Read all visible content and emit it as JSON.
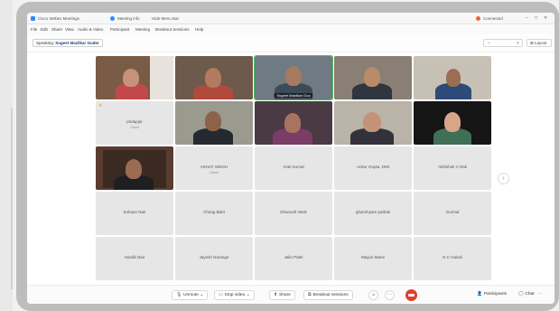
{
  "titlebar": {
    "app_title": "Cisco Webex Meetings",
    "meeting_info": "Meeting info",
    "hide_menu": "Hide Menu Bar",
    "connected": "Connected",
    "win_controls": [
      "–",
      "□",
      "✕"
    ]
  },
  "menubar": {
    "items": [
      "File",
      "Edit",
      "Share",
      "View",
      "Audio & Video",
      "Participant",
      "Meeting",
      "Breakout Sessions",
      "Help"
    ]
  },
  "speaking": {
    "prefix": "Speaking:",
    "name": "Sugeet Mazilkar Guder"
  },
  "view": {
    "zoom_minus": "−",
    "zoom_plus": "+",
    "gallery_label": "Layout"
  },
  "tiles": [
    {
      "name": "",
      "kind": "video"
    },
    {
      "name": "",
      "kind": "video"
    },
    {
      "name": "Sugeet Mazilkar Guo",
      "kind": "video",
      "active": true
    },
    {
      "name": "",
      "kind": "video"
    },
    {
      "name": "",
      "kind": "video"
    },
    {
      "name": "pridupjar",
      "kind": "name",
      "sub": "Guest"
    },
    {
      "name": "",
      "kind": "video"
    },
    {
      "name": "",
      "kind": "video"
    },
    {
      "name": "",
      "kind": "video"
    },
    {
      "name": "",
      "kind": "video"
    },
    {
      "name": "",
      "kind": "video"
    },
    {
      "name": "AKHAY SINGH",
      "kind": "name",
      "sub": "Guest"
    },
    {
      "name": "Arati Korvat",
      "kind": "name"
    },
    {
      "name": "Ankur Gupta, DMI",
      "kind": "name"
    },
    {
      "name": "Abhishek V Dak",
      "kind": "name"
    },
    {
      "name": "Sohaan Nair",
      "kind": "name"
    },
    {
      "name": "Chirag Baht",
      "kind": "name"
    },
    {
      "name": "Dhanush Nesk",
      "kind": "name"
    },
    {
      "name": "ghanshyam pathak",
      "kind": "name"
    },
    {
      "name": "Gurmal",
      "kind": "name"
    },
    {
      "name": "Hardik Nair",
      "kind": "name"
    },
    {
      "name": "Jayesh Narange",
      "kind": "name"
    },
    {
      "name": "Jalin Patel",
      "kind": "name"
    },
    {
      "name": "Mayuri Mane",
      "kind": "name"
    },
    {
      "name": "N C Hasali",
      "kind": "name"
    }
  ],
  "toolbar": {
    "unmute": "Unmute",
    "stop_video": "Stop video",
    "share": "Share",
    "breakout": "Breakout sessions",
    "more": "···",
    "participants": "Participants",
    "chat": "Chat",
    "chevron": "⌄",
    "overflow": "···"
  },
  "colors": {
    "end_call": "#e53b2c",
    "active_speaker": "#49c35b",
    "accent": "#2d8cff"
  }
}
